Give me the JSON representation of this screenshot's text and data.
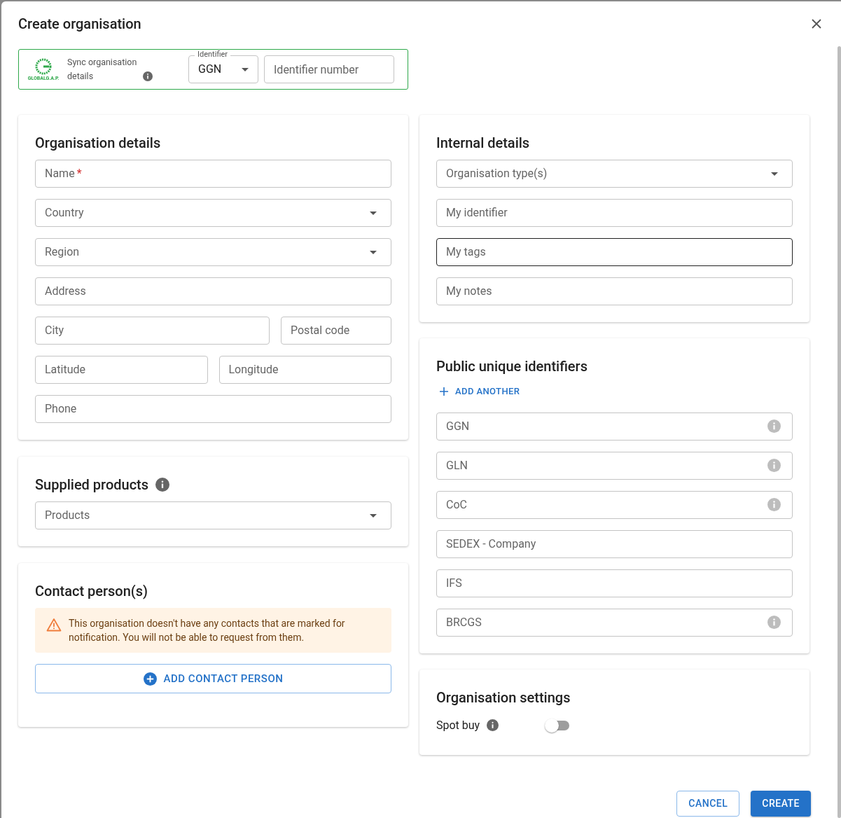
{
  "dialog": {
    "title": "Create organisation"
  },
  "sync": {
    "logo_text": "GLOBALG.A.P.",
    "label": "Sync organisation details",
    "identifier": {
      "label": "Identifier",
      "value": "GGN"
    },
    "number": {
      "placeholder": "Identifier number"
    }
  },
  "organisation_details": {
    "title": "Organisation details",
    "rows": [
      [
        {
          "placeholder": "Name",
          "required_mark": "*",
          "kind": "text"
        }
      ],
      [
        {
          "placeholder": "Country",
          "kind": "select"
        }
      ],
      [
        {
          "placeholder": "Region",
          "kind": "select"
        }
      ],
      [
        {
          "placeholder": "Address",
          "kind": "text"
        }
      ],
      [
        {
          "placeholder": "City",
          "kind": "text"
        },
        {
          "placeholder": "Postal code",
          "kind": "text"
        }
      ],
      [
        {
          "placeholder": "Latitude",
          "kind": "text"
        },
        {
          "placeholder": "Longitude",
          "kind": "text"
        }
      ],
      [
        {
          "placeholder": "Phone",
          "kind": "text"
        }
      ]
    ]
  },
  "supplied_products": {
    "title": "Supplied products",
    "field": {
      "placeholder": "Products",
      "kind": "select"
    }
  },
  "contacts": {
    "title": "Contact person(s)",
    "warning": "This organisation doesn't have any contacts that are marked for notification. You will not be able to request from them.",
    "button": "ADD CONTACT PERSON"
  },
  "internal_details": {
    "title": "Internal details",
    "fields": [
      {
        "placeholder": "Organisation type(s)",
        "kind": "select",
        "focused": false
      },
      {
        "placeholder": "My identifier",
        "kind": "text",
        "focused": false
      },
      {
        "placeholder": "My tags",
        "kind": "text",
        "focused": true
      },
      {
        "placeholder": "My notes",
        "kind": "text",
        "focused": false
      }
    ]
  },
  "public_identifiers": {
    "title": "Public unique identifiers",
    "add_button": "ADD ANOTHER",
    "fields": [
      {
        "placeholder": "GGN",
        "info": true
      },
      {
        "placeholder": "GLN",
        "info": true
      },
      {
        "placeholder": "CoC",
        "info": true
      },
      {
        "placeholder": "SEDEX - Company",
        "info": false
      },
      {
        "placeholder": "IFS",
        "info": false
      },
      {
        "placeholder": "BRCGS",
        "info": true
      }
    ]
  },
  "organisation_settings": {
    "title": "Organisation settings",
    "toggles": [
      {
        "label": "Spot buy",
        "on": false
      }
    ]
  },
  "buttons": [
    {
      "label": "CANCEL",
      "kind": "outlined"
    },
    {
      "label": "CREATE",
      "kind": "contained"
    }
  ]
}
